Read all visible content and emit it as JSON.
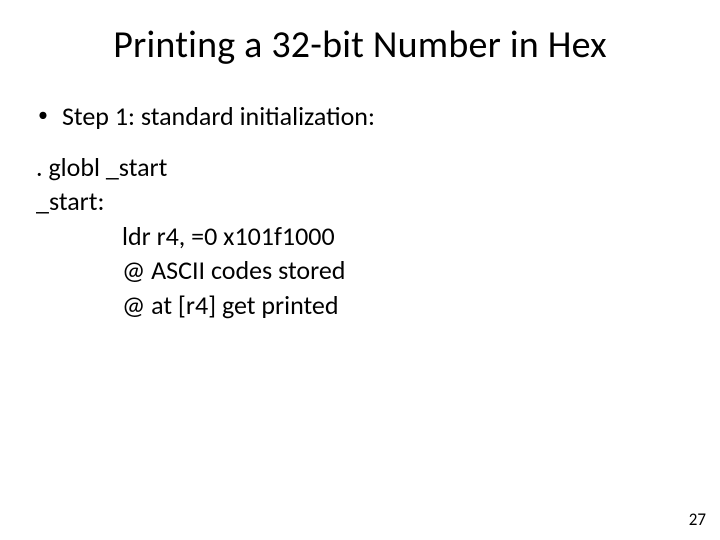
{
  "title": "Printing a 32-bit Number in Hex",
  "bullet": "Step 1: standard initialization:",
  "code": {
    "l1": ". globl _start",
    "l2": "_start:",
    "l3": "ldr r4, =0 x101f1000",
    "l4": "@ ASCII codes stored",
    "l5": "@ at [r4] get printed"
  },
  "page": "27"
}
